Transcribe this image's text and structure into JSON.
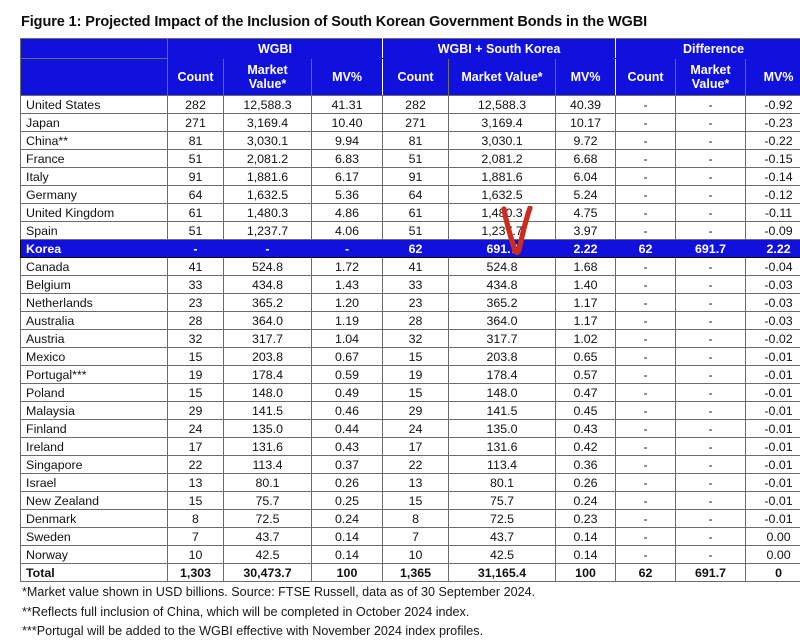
{
  "figure": {
    "title": "Figure 1: Projected Impact of the Inclusion of South Korean Government Bonds in the WGBI"
  },
  "table": {
    "corner_label": "",
    "group_headers": [
      "WGBI",
      "WGBI + South Korea",
      "Difference"
    ],
    "sub_headers": {
      "wgbi": [
        "Count",
        "Market Value*",
        "MV%"
      ],
      "wgbi_korea": [
        "Count",
        "Market Value*",
        "MV%"
      ],
      "difference": [
        "Count",
        "Market Value*",
        "MV%"
      ]
    },
    "sub_headers_wrapped": {
      "market_value_line1": "Market",
      "market_value_line2": "Value*",
      "count": "Count",
      "mvpct": "MV%",
      "market_value_full": "Market Value*"
    },
    "rows": [
      {
        "name": "United States",
        "w_count": "282",
        "w_mv": "12,588.3",
        "w_pct": "41.31",
        "k_count": "282",
        "k_mv": "12,588.3",
        "k_pct": "40.39",
        "d_count": "-",
        "d_mv": "-",
        "d_pct": "-0.92"
      },
      {
        "name": "Japan",
        "w_count": "271",
        "w_mv": "3,169.4",
        "w_pct": "10.40",
        "k_count": "271",
        "k_mv": "3,169.4",
        "k_pct": "10.17",
        "d_count": "-",
        "d_mv": "-",
        "d_pct": "-0.23"
      },
      {
        "name": "China**",
        "w_count": "81",
        "w_mv": "3,030.1",
        "w_pct": "9.94",
        "k_count": "81",
        "k_mv": "3,030.1",
        "k_pct": "9.72",
        "d_count": "-",
        "d_mv": "-",
        "d_pct": "-0.22"
      },
      {
        "name": "France",
        "w_count": "51",
        "w_mv": "2,081.2",
        "w_pct": "6.83",
        "k_count": "51",
        "k_mv": "2,081.2",
        "k_pct": "6.68",
        "d_count": "-",
        "d_mv": "-",
        "d_pct": "-0.15"
      },
      {
        "name": "Italy",
        "w_count": "91",
        "w_mv": "1,881.6",
        "w_pct": "6.17",
        "k_count": "91",
        "k_mv": "1,881.6",
        "k_pct": "6.04",
        "d_count": "-",
        "d_mv": "-",
        "d_pct": "-0.14"
      },
      {
        "name": "Germany",
        "w_count": "64",
        "w_mv": "1,632.5",
        "w_pct": "5.36",
        "k_count": "64",
        "k_mv": "1,632.5",
        "k_pct": "5.24",
        "d_count": "-",
        "d_mv": "-",
        "d_pct": "-0.12"
      },
      {
        "name": "United Kingdom",
        "w_count": "61",
        "w_mv": "1,480.3",
        "w_pct": "4.86",
        "k_count": "61",
        "k_mv": "1,480.3",
        "k_pct": "4.75",
        "d_count": "-",
        "d_mv": "-",
        "d_pct": "-0.11"
      },
      {
        "name": "Spain",
        "w_count": "51",
        "w_mv": "1,237.7",
        "w_pct": "4.06",
        "k_count": "51",
        "k_mv": "1,237.7",
        "k_pct": "3.97",
        "d_count": "-",
        "d_mv": "-",
        "d_pct": "-0.09"
      },
      {
        "name": "Korea",
        "w_count": "-",
        "w_mv": "-",
        "w_pct": "-",
        "k_count": "62",
        "k_mv": "691.7",
        "k_pct": "2.22",
        "d_count": "62",
        "d_mv": "691.7",
        "d_pct": "2.22",
        "highlight": true
      },
      {
        "name": "Canada",
        "w_count": "41",
        "w_mv": "524.8",
        "w_pct": "1.72",
        "k_count": "41",
        "k_mv": "524.8",
        "k_pct": "1.68",
        "d_count": "-",
        "d_mv": "-",
        "d_pct": "-0.04"
      },
      {
        "name": "Belgium",
        "w_count": "33",
        "w_mv": "434.8",
        "w_pct": "1.43",
        "k_count": "33",
        "k_mv": "434.8",
        "k_pct": "1.40",
        "d_count": "-",
        "d_mv": "-",
        "d_pct": "-0.03"
      },
      {
        "name": "Netherlands",
        "w_count": "23",
        "w_mv": "365.2",
        "w_pct": "1.20",
        "k_count": "23",
        "k_mv": "365.2",
        "k_pct": "1.17",
        "d_count": "-",
        "d_mv": "-",
        "d_pct": "-0.03"
      },
      {
        "name": "Australia",
        "w_count": "28",
        "w_mv": "364.0",
        "w_pct": "1.19",
        "k_count": "28",
        "k_mv": "364.0",
        "k_pct": "1.17",
        "d_count": "-",
        "d_mv": "-",
        "d_pct": "-0.03"
      },
      {
        "name": "Austria",
        "w_count": "32",
        "w_mv": "317.7",
        "w_pct": "1.04",
        "k_count": "32",
        "k_mv": "317.7",
        "k_pct": "1.02",
        "d_count": "-",
        "d_mv": "-",
        "d_pct": "-0.02"
      },
      {
        "name": "Mexico",
        "w_count": "15",
        "w_mv": "203.8",
        "w_pct": "0.67",
        "k_count": "15",
        "k_mv": "203.8",
        "k_pct": "0.65",
        "d_count": "-",
        "d_mv": "-",
        "d_pct": "-0.01"
      },
      {
        "name": "Portugal***",
        "w_count": "19",
        "w_mv": "178.4",
        "w_pct": "0.59",
        "k_count": "19",
        "k_mv": "178.4",
        "k_pct": "0.57",
        "d_count": "-",
        "d_mv": "-",
        "d_pct": "-0.01"
      },
      {
        "name": "Poland",
        "w_count": "15",
        "w_mv": "148.0",
        "w_pct": "0.49",
        "k_count": "15",
        "k_mv": "148.0",
        "k_pct": "0.47",
        "d_count": "-",
        "d_mv": "-",
        "d_pct": "-0.01"
      },
      {
        "name": "Malaysia",
        "w_count": "29",
        "w_mv": "141.5",
        "w_pct": "0.46",
        "k_count": "29",
        "k_mv": "141.5",
        "k_pct": "0.45",
        "d_count": "-",
        "d_mv": "-",
        "d_pct": "-0.01"
      },
      {
        "name": "Finland",
        "w_count": "24",
        "w_mv": "135.0",
        "w_pct": "0.44",
        "k_count": "24",
        "k_mv": "135.0",
        "k_pct": "0.43",
        "d_count": "-",
        "d_mv": "-",
        "d_pct": "-0.01"
      },
      {
        "name": "Ireland",
        "w_count": "17",
        "w_mv": "131.6",
        "w_pct": "0.43",
        "k_count": "17",
        "k_mv": "131.6",
        "k_pct": "0.42",
        "d_count": "-",
        "d_mv": "-",
        "d_pct": "-0.01"
      },
      {
        "name": "Singapore",
        "w_count": "22",
        "w_mv": "113.4",
        "w_pct": "0.37",
        "k_count": "22",
        "k_mv": "113.4",
        "k_pct": "0.36",
        "d_count": "-",
        "d_mv": "-",
        "d_pct": "-0.01"
      },
      {
        "name": "Israel",
        "w_count": "13",
        "w_mv": "80.1",
        "w_pct": "0.26",
        "k_count": "13",
        "k_mv": "80.1",
        "k_pct": "0.26",
        "d_count": "-",
        "d_mv": "-",
        "d_pct": "-0.01"
      },
      {
        "name": "New Zealand",
        "w_count": "15",
        "w_mv": "75.7",
        "w_pct": "0.25",
        "k_count": "15",
        "k_mv": "75.7",
        "k_pct": "0.24",
        "d_count": "-",
        "d_mv": "-",
        "d_pct": "-0.01"
      },
      {
        "name": "Denmark",
        "w_count": "8",
        "w_mv": "72.5",
        "w_pct": "0.24",
        "k_count": "8",
        "k_mv": "72.5",
        "k_pct": "0.23",
        "d_count": "-",
        "d_mv": "-",
        "d_pct": "-0.01"
      },
      {
        "name": "Sweden",
        "w_count": "7",
        "w_mv": "43.7",
        "w_pct": "0.14",
        "k_count": "7",
        "k_mv": "43.7",
        "k_pct": "0.14",
        "d_count": "-",
        "d_mv": "-",
        "d_pct": "0.00"
      },
      {
        "name": "Norway",
        "w_count": "10",
        "w_mv": "42.5",
        "w_pct": "0.14",
        "k_count": "10",
        "k_mv": "42.5",
        "k_pct": "0.14",
        "d_count": "-",
        "d_mv": "-",
        "d_pct": "0.00"
      },
      {
        "name": "Total",
        "w_count": "1,303",
        "w_mv": "30,473.7",
        "w_pct": "100",
        "k_count": "1,365",
        "k_mv": "31,165.4",
        "k_pct": "100",
        "d_count": "62",
        "d_mv": "691.7",
        "d_pct": "0",
        "total": true
      }
    ]
  },
  "notes": [
    "*Market value shown in USD billions. Source: FTSE Russell, data as of 30 September 2024.",
    "**Reflects full inclusion of China, which will be completed in October 2024 index.",
    "***Portugal will be added to the WGBI effective with November 2024 index profiles."
  ],
  "annotation": {
    "mark": "red-check-v",
    "color": "#cc2b1d",
    "target_row": "Korea"
  },
  "colors": {
    "header_blue": "#1111dd",
    "highlight_blue": "#1111dd",
    "text": "#111111",
    "annotation_red": "#cc2b1d"
  }
}
